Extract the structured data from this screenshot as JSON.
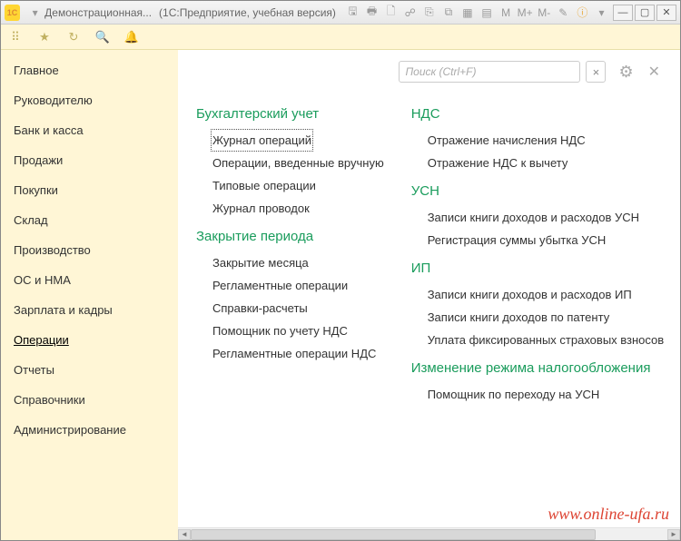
{
  "window": {
    "title1": "Демонстрационная...",
    "title2": "(1С:Предприятие, учебная версия)",
    "mbuttons": [
      "M",
      "M+",
      "M-"
    ]
  },
  "search": {
    "placeholder": "Поиск (Ctrl+F)"
  },
  "sidebar": {
    "items": [
      {
        "label": "Главное"
      },
      {
        "label": "Руководителю"
      },
      {
        "label": "Банк и касса"
      },
      {
        "label": "Продажи"
      },
      {
        "label": "Покупки"
      },
      {
        "label": "Склад"
      },
      {
        "label": "Производство"
      },
      {
        "label": "ОС и НМА"
      },
      {
        "label": "Зарплата и кадры"
      },
      {
        "label": "Операции",
        "active": true
      },
      {
        "label": "Отчеты"
      },
      {
        "label": "Справочники"
      },
      {
        "label": "Администрирование"
      }
    ]
  },
  "cols": {
    "left": [
      {
        "title": "Бухгалтерский учет",
        "items": [
          {
            "label": "Журнал операций",
            "hl": true
          },
          {
            "label": "Операции, введенные вручную"
          },
          {
            "label": "Типовые операции"
          },
          {
            "label": "Журнал проводок"
          }
        ]
      },
      {
        "title": "Закрытие периода",
        "items": [
          {
            "label": "Закрытие месяца"
          },
          {
            "label": "Регламентные операции"
          },
          {
            "label": "Справки-расчеты"
          },
          {
            "label": "Помощник по учету НДС"
          },
          {
            "label": "Регламентные операции НДС"
          }
        ]
      }
    ],
    "right": [
      {
        "title": "НДС",
        "items": [
          {
            "label": "Отражение начисления НДС"
          },
          {
            "label": "Отражение НДС к вычету"
          }
        ]
      },
      {
        "title": "УСН",
        "items": [
          {
            "label": "Записи книги доходов и расходов УСН"
          },
          {
            "label": "Регистрация суммы убытка УСН"
          }
        ]
      },
      {
        "title": "ИП",
        "items": [
          {
            "label": "Записи книги доходов и расходов ИП"
          },
          {
            "label": "Записи книги доходов по патенту"
          },
          {
            "label": "Уплата фиксированных страховых взносов"
          }
        ]
      },
      {
        "title": "Изменение режима налогообложения",
        "items": [
          {
            "label": "Помощник по переходу на УСН"
          }
        ]
      }
    ]
  },
  "watermark": "www.online-ufa.ru"
}
